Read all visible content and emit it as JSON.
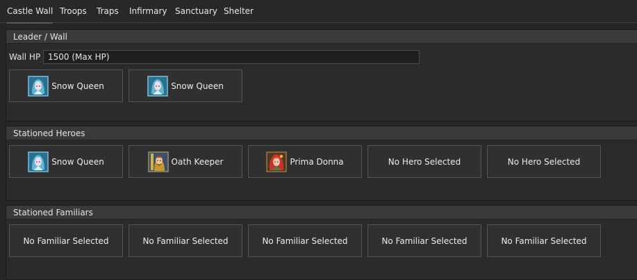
{
  "tabs": [
    {
      "label": "Castle Wall",
      "active": true
    },
    {
      "label": "Troops",
      "active": false
    },
    {
      "label": "Traps",
      "active": false
    },
    {
      "label": "Infirmary",
      "active": false
    },
    {
      "label": "Sanctuary",
      "active": false
    },
    {
      "label": "Shelter",
      "active": false
    }
  ],
  "leader_wall": {
    "title": "Leader / Wall",
    "wall_hp_label": "Wall HP",
    "wall_hp_value": "1500 (Max HP)",
    "slots": [
      {
        "label": "Snow Queen",
        "icon": "snow-queen-portrait-icon"
      },
      {
        "label": "Snow Queen",
        "icon": "snow-queen-portrait-icon"
      }
    ]
  },
  "stationed_heroes": {
    "title": "Stationed Heroes",
    "slots": [
      {
        "label": "Snow Queen",
        "icon": "snow-queen-portrait-icon"
      },
      {
        "label": "Oath Keeper",
        "icon": "oath-keeper-portrait-icon"
      },
      {
        "label": "Prima Donna",
        "icon": "prima-donna-portrait-icon"
      },
      {
        "label": "No Hero Selected",
        "icon": ""
      },
      {
        "label": "No Hero Selected",
        "icon": ""
      }
    ]
  },
  "stationed_familiars": {
    "title": "Stationed Familiars",
    "slots": [
      {
        "label": "No Familiar Selected"
      },
      {
        "label": "No Familiar Selected"
      },
      {
        "label": "No Familiar Selected"
      },
      {
        "label": "No Familiar Selected"
      },
      {
        "label": "No Familiar Selected"
      }
    ]
  }
}
